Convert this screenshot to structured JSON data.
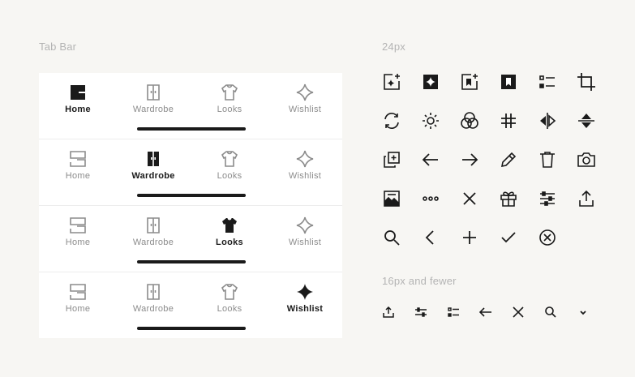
{
  "tabbar": {
    "title": "Tab Bar",
    "rows": [
      {
        "active": "home",
        "items": [
          "Home",
          "Wardrobe",
          "Looks",
          "Wishlist"
        ]
      },
      {
        "active": "wardrobe",
        "items": [
          "Home",
          "Wardrobe",
          "Looks",
          "Wishlist"
        ]
      },
      {
        "active": "looks",
        "items": [
          "Home",
          "Wardrobe",
          "Looks",
          "Wishlist"
        ]
      },
      {
        "active": "wishlist",
        "items": [
          "Home",
          "Wardrobe",
          "Looks",
          "Wishlist"
        ]
      }
    ]
  },
  "icons24": {
    "title": "24px",
    "icons": [
      "sparkle-add-icon",
      "sparkle-filled-icon",
      "bookmark-add-icon",
      "bookmark-filled-icon",
      "list-icon",
      "crop-icon",
      "refresh-icon",
      "brightness-icon",
      "color-mix-icon",
      "hashtag-icon",
      "flip-horizontal-icon",
      "flip-vertical-icon",
      "duplicate-icon",
      "arrow-left-icon",
      "arrow-right-icon",
      "pencil-icon",
      "trash-icon",
      "camera-icon",
      "image-icon",
      "more-horizontal-icon",
      "close-icon",
      "gift-icon",
      "sliders-icon",
      "share-icon",
      "search-icon",
      "chevron-left-icon",
      "plus-icon",
      "check-icon",
      "close-circle-icon"
    ]
  },
  "icons16": {
    "title": "16px and fewer",
    "icons": [
      "share-icon",
      "sliders-icon",
      "list-icon",
      "arrow-left-icon",
      "close-icon",
      "search-icon",
      "chevron-down-icon"
    ]
  }
}
